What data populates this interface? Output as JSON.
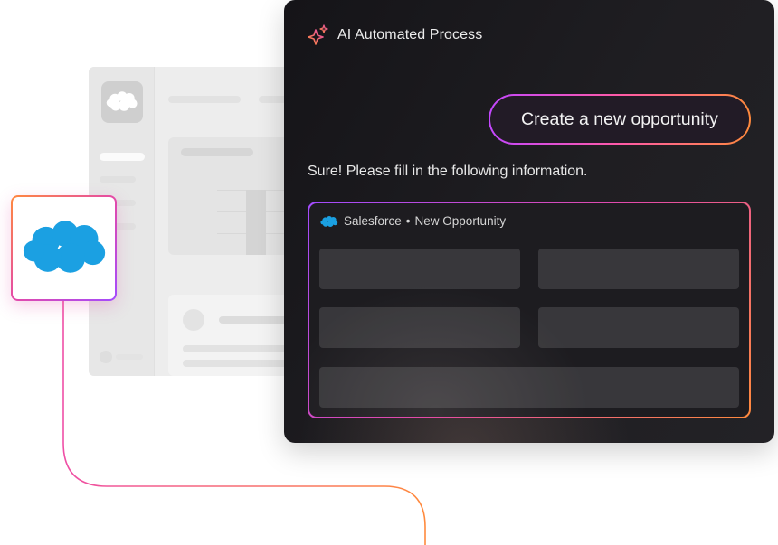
{
  "ai_panel": {
    "title": "AI Automated Process",
    "header_icon": "sparkle-icon",
    "user_prompt": "Create a new opportunity",
    "assistant_reply": "Sure! Please fill in the following information."
  },
  "form": {
    "source": "Salesforce",
    "separator": "•",
    "title": "New Opportunity",
    "source_icon": "salesforce-cloud-icon",
    "fields": [
      {
        "value": ""
      },
      {
        "value": ""
      },
      {
        "value": ""
      },
      {
        "value": ""
      },
      {
        "value": ""
      }
    ]
  },
  "integration_tile": {
    "icon": "salesforce-cloud-icon"
  },
  "colors": {
    "salesforce_blue": "#1ba0e2",
    "gradient_orange": "#ff8a3d",
    "gradient_pink": "#e44aa8",
    "gradient_purple": "#a24bff",
    "panel_dark": "#1b1a1e"
  }
}
